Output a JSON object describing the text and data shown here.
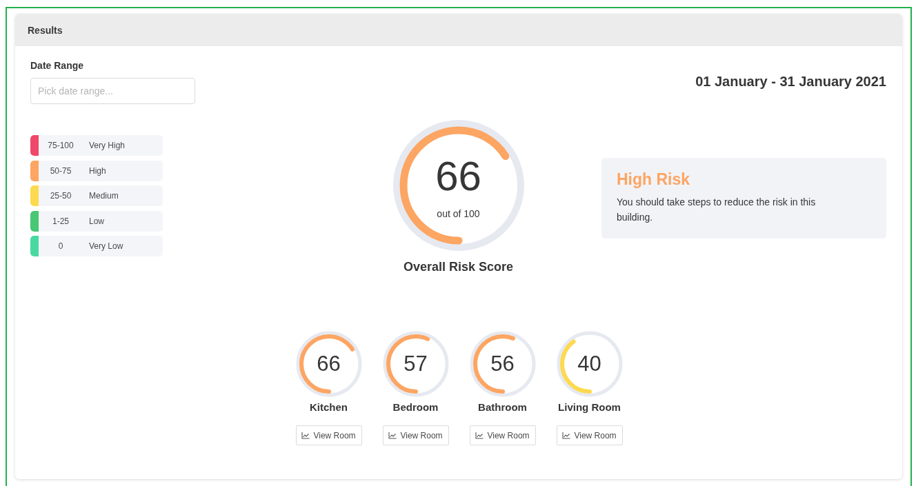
{
  "card": {
    "title": "Results"
  },
  "date_range": {
    "label": "Date Range",
    "placeholder": "Pick date range..."
  },
  "period_title": "01 January - 31 January 2021",
  "legend": [
    {
      "range": "75-100",
      "label": "Very High",
      "color": "#f0486a"
    },
    {
      "range": "50-75",
      "label": "High",
      "color": "#fda562"
    },
    {
      "range": "25-50",
      "label": "Medium",
      "color": "#fdd94f"
    },
    {
      "range": "1-25",
      "label": "Low",
      "color": "#48c774"
    },
    {
      "range": "0",
      "label": "Very Low",
      "color": "#48d9a0"
    }
  ],
  "overall": {
    "score": "66",
    "caption": "out of 100",
    "label": "Overall Risk Score",
    "level": 0.66,
    "color": "#fda562"
  },
  "risk": {
    "title": "High Risk",
    "message": "You should take steps to reduce the risk in this building.",
    "color": "#fda562"
  },
  "rooms": [
    {
      "name": "Kitchen",
      "score": "66",
      "level": 0.66,
      "color": "#fda562",
      "button": "View Room"
    },
    {
      "name": "Bedroom",
      "score": "57",
      "level": 0.57,
      "color": "#fda562",
      "button": "View Room"
    },
    {
      "name": "Bathroom",
      "score": "56",
      "level": 0.56,
      "color": "#fda562",
      "button": "View Room"
    },
    {
      "name": "Living Room",
      "score": "40",
      "level": 0.4,
      "color": "#fdd94f",
      "button": "View Room"
    }
  ]
}
